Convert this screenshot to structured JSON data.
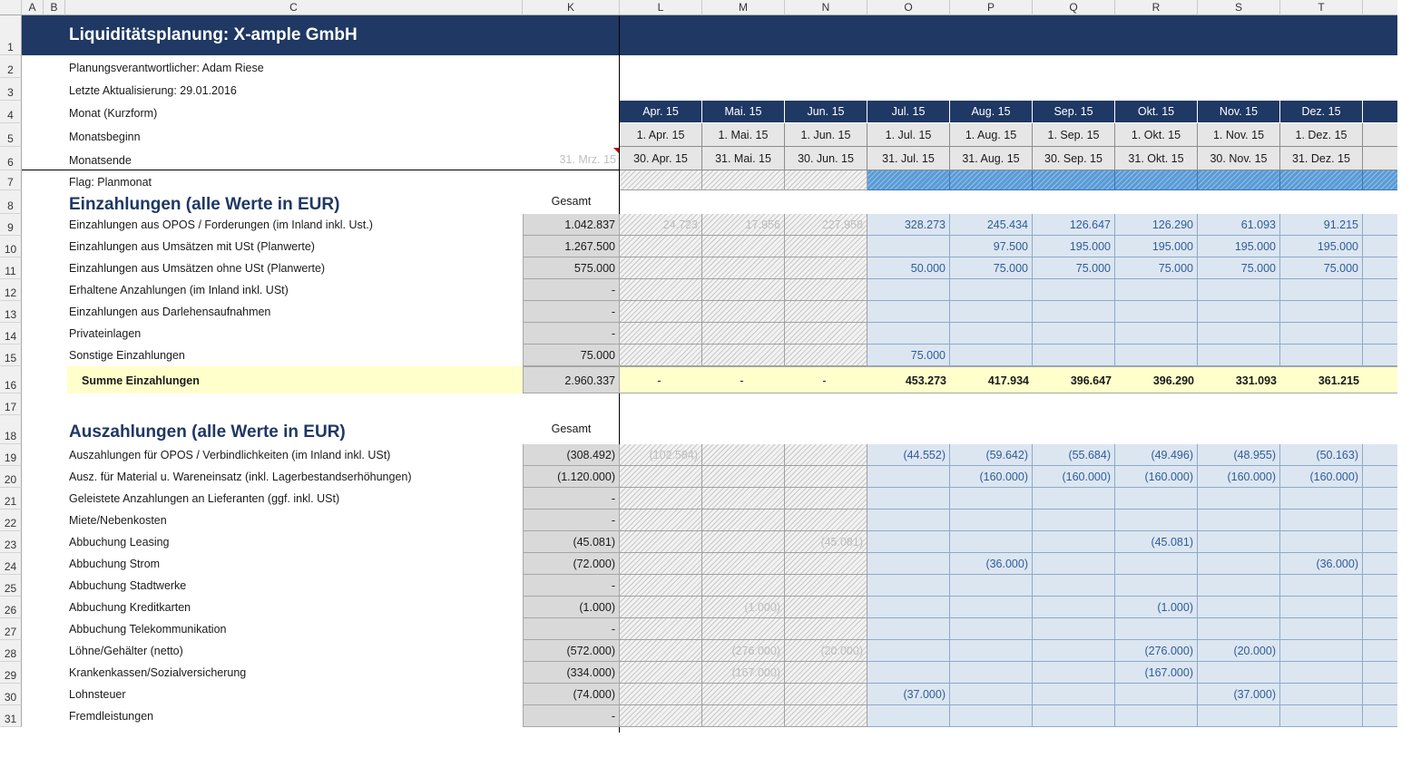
{
  "column_headers": [
    "A",
    "B",
    "C",
    "K",
    "L",
    "M",
    "N",
    "O",
    "P",
    "Q",
    "R",
    "S",
    "T"
  ],
  "title": "Liquiditätsplanung: X-ample GmbH",
  "meta": {
    "responsible": "Planungsverantwortlicher: Adam Riese",
    "last_update": "Letzte Aktualisierung: 29.01.2016",
    "month_short_label": "Monat (Kurzform)",
    "month_start_label": "Monatsbeginn",
    "month_end_label": "Monatsende",
    "k_month_end": "31. Mrz. 15",
    "flag_label": "Flag: Planmonat"
  },
  "months": [
    {
      "col": "L",
      "short": "Apr. 15",
      "start": "1. Apr. 15",
      "end": "30. Apr. 15",
      "plan": false
    },
    {
      "col": "M",
      "short": "Mai. 15",
      "start": "1. Mai. 15",
      "end": "31. Mai. 15",
      "plan": false
    },
    {
      "col": "N",
      "short": "Jun. 15",
      "start": "1. Jun. 15",
      "end": "30. Jun. 15",
      "plan": false
    },
    {
      "col": "O",
      "short": "Jul. 15",
      "start": "1. Jul. 15",
      "end": "31. Jul. 15",
      "plan": true
    },
    {
      "col": "P",
      "short": "Aug. 15",
      "start": "1. Aug. 15",
      "end": "31. Aug. 15",
      "plan": true
    },
    {
      "col": "Q",
      "short": "Sep. 15",
      "start": "1. Sep. 15",
      "end": "30. Sep. 15",
      "plan": true
    },
    {
      "col": "R",
      "short": "Okt. 15",
      "start": "1. Okt. 15",
      "end": "31. Okt. 15",
      "plan": true
    },
    {
      "col": "S",
      "short": "Nov. 15",
      "start": "1. Nov. 15",
      "end": "30. Nov. 15",
      "plan": true
    },
    {
      "col": "T",
      "short": "Dez. 15",
      "start": "1. Dez. 15",
      "end": "31. Dez. 15",
      "plan": true
    }
  ],
  "einzahlungen": {
    "heading": "Einzahlungen (alle Werte in EUR)",
    "total_label": "Gesamt",
    "rows": [
      {
        "label": "Einzahlungen aus OPOS / Forderungen (im Inland inkl. Ust.)",
        "total": "1.042.837",
        "values": [
          "24.723",
          "17.956",
          "227.958",
          "328.273",
          "245.434",
          "126.647",
          "126.290",
          "61.093",
          "91.215"
        ]
      },
      {
        "label": "Einzahlungen aus Umsätzen mit USt (Planwerte)",
        "total": "1.267.500",
        "values": [
          "",
          "",
          "",
          "",
          "97.500",
          "195.000",
          "195.000",
          "195.000",
          "195.000"
        ]
      },
      {
        "label": "Einzahlungen aus Umsätzen ohne USt (Planwerte)",
        "total": "575.000",
        "values": [
          "",
          "",
          "",
          "50.000",
          "75.000",
          "75.000",
          "75.000",
          "75.000",
          "75.000"
        ]
      },
      {
        "label": "Erhaltene Anzahlungen (im Inland inkl. USt)",
        "total": "-",
        "values": [
          "",
          "",
          "",
          "",
          "",
          "",
          "",
          "",
          ""
        ]
      },
      {
        "label": "Einzahlungen aus Darlehensaufnahmen",
        "total": "-",
        "values": [
          "",
          "",
          "",
          "",
          "",
          "",
          "",
          "",
          ""
        ]
      },
      {
        "label": "Privateinlagen",
        "total": "-",
        "values": [
          "",
          "",
          "",
          "",
          "",
          "",
          "",
          "",
          ""
        ]
      },
      {
        "label": "Sonstige Einzahlungen",
        "total": "75.000",
        "values": [
          "",
          "",
          "",
          "75.000",
          "",
          "",
          "",
          "",
          ""
        ]
      }
    ],
    "sum": {
      "label": "Summe Einzahlungen",
      "total": "2.960.337",
      "values": [
        "-",
        "-",
        "-",
        "453.273",
        "417.934",
        "396.647",
        "396.290",
        "331.093",
        "361.215"
      ]
    }
  },
  "auszahlungen": {
    "heading": "Auszahlungen (alle Werte in EUR)",
    "total_label": "Gesamt",
    "rows": [
      {
        "label": "Auszahlungen für OPOS / Verbindlichkeiten (im Inland inkl. USt)",
        "total": "(308.492)",
        "values": [
          "(102.584)",
          "",
          "",
          "(44.552)",
          "(59.642)",
          "(55.684)",
          "(49.496)",
          "(48.955)",
          "(50.163)"
        ]
      },
      {
        "label": "Ausz. für Material u. Wareneinsatz (inkl. Lagerbestandserhöhungen)",
        "total": "(1.120.000)",
        "values": [
          "",
          "",
          "",
          "",
          "(160.000)",
          "(160.000)",
          "(160.000)",
          "(160.000)",
          "(160.000)"
        ]
      },
      {
        "label": "Geleistete Anzahlungen an Lieferanten (ggf. inkl. USt)",
        "total": "-",
        "values": [
          "",
          "",
          "",
          "",
          "",
          "",
          "",
          "",
          ""
        ]
      },
      {
        "label": "Miete/Nebenkosten",
        "total": "-",
        "values": [
          "",
          "",
          "",
          "",
          "",
          "",
          "",
          "",
          ""
        ]
      },
      {
        "label": "Abbuchung Leasing",
        "total": "(45.081)",
        "values": [
          "",
          "",
          "(45.081)",
          "",
          "",
          "",
          "(45.081)",
          "",
          ""
        ]
      },
      {
        "label": "Abbuchung Strom",
        "total": "(72.000)",
        "values": [
          "",
          "",
          "",
          "",
          "(36.000)",
          "",
          "",
          "",
          "(36.000)"
        ]
      },
      {
        "label": "Abbuchung Stadtwerke",
        "total": "-",
        "values": [
          "",
          "",
          "",
          "",
          "",
          "",
          "",
          "",
          ""
        ]
      },
      {
        "label": "Abbuchung Kreditkarten",
        "total": "(1.000)",
        "values": [
          "",
          "(1.000)",
          "",
          "",
          "",
          "",
          "(1.000)",
          "",
          ""
        ]
      },
      {
        "label": "Abbuchung Telekommunikation",
        "total": "-",
        "values": [
          "",
          "",
          "",
          "",
          "",
          "",
          "",
          "",
          ""
        ]
      },
      {
        "label": "Löhne/Gehälter (netto)",
        "total": "(572.000)",
        "values": [
          "",
          "(276.000)",
          "(20.000)",
          "",
          "",
          "",
          "(276.000)",
          "(20.000)",
          ""
        ]
      },
      {
        "label": "Krankenkassen/Sozialversicherung",
        "total": "(334.000)",
        "values": [
          "",
          "(167.000)",
          "",
          "",
          "",
          "",
          "(167.000)",
          "",
          ""
        ]
      },
      {
        "label": "Lohnsteuer",
        "total": "(74.000)",
        "values": [
          "",
          "",
          "",
          "(37.000)",
          "",
          "",
          "",
          "(37.000)",
          ""
        ]
      },
      {
        "label": "Fremdleistungen",
        "total": "-",
        "values": [
          "",
          "",
          "",
          "",
          "",
          "",
          "",
          "",
          ""
        ]
      }
    ]
  },
  "row_numbers": [
    "1",
    "2",
    "3",
    "4",
    "5",
    "6",
    "7",
    "8",
    "9",
    "10",
    "11",
    "12",
    "13",
    "14",
    "15",
    "16",
    "17",
    "18",
    "19",
    "20",
    "21",
    "22",
    "23",
    "24",
    "25",
    "26",
    "27",
    "28",
    "29",
    "30",
    "31"
  ]
}
